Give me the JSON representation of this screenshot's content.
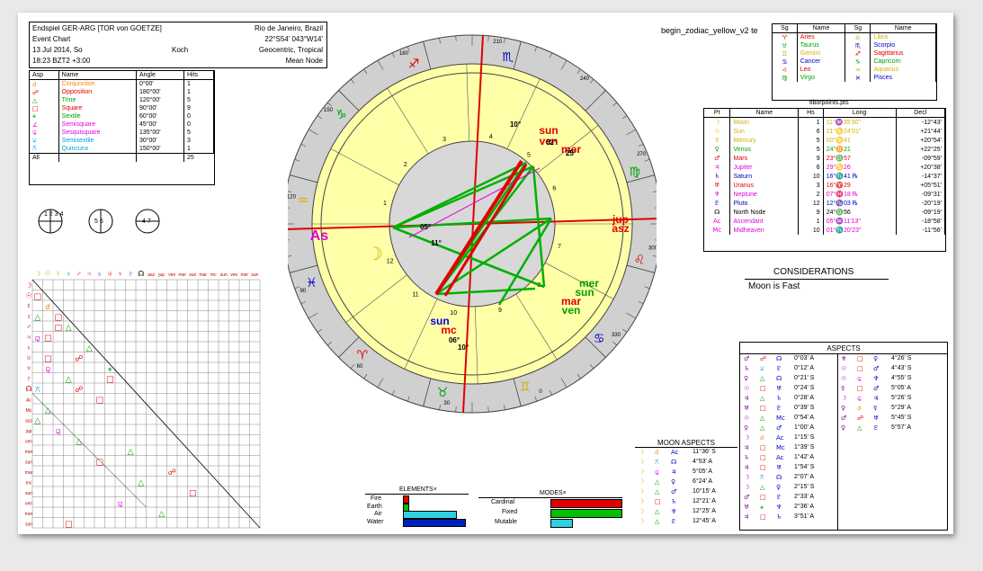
{
  "header": {
    "title": "Endspiel GER-ARG [TOR von GOETZE]",
    "type": "Event Chart",
    "date": "13 Jul 2014, So",
    "time": "18:23 BZT2 +3:00",
    "house_system": "Koch",
    "place": "Rio de Janeiro, Brazil",
    "coords": "22°S54' 043°W14'",
    "zodiac": "Geocentric, Tropical",
    "node": "Mean Node"
  },
  "file_label": "begin_zodiac_yellow_v2 te",
  "aspect_table": {
    "headers": [
      "Asp",
      "Name",
      "Angle",
      "Hits"
    ],
    "rows": [
      {
        "sym": "☌",
        "name": "Conjunction",
        "angle": "0°00'",
        "hits": "1",
        "color": "#ff8000"
      },
      {
        "sym": "☍",
        "name": "Opposition",
        "angle": "180°00'",
        "hits": "1",
        "color": "#e00000"
      },
      {
        "sym": "△",
        "name": "Trine",
        "angle": "120°00'",
        "hits": "5",
        "color": "#00a000"
      },
      {
        "sym": "□",
        "name": "Square",
        "angle": "90°00'",
        "hits": "9",
        "color": "#e00000"
      },
      {
        "sym": "⚹",
        "name": "Sextile",
        "angle": "60°00'",
        "hits": "0",
        "color": "#00a000"
      },
      {
        "sym": "∠",
        "name": "Semisquare",
        "angle": "45°00'",
        "hits": "0",
        "color": "#e000e0"
      },
      {
        "sym": "⚼",
        "name": "Sesquisquare",
        "angle": "135°00'",
        "hits": "5",
        "color": "#e000e0"
      },
      {
        "sym": "⚺",
        "name": "Semisextile",
        "angle": "30°00'",
        "hits": "3",
        "color": "#00a0e0"
      },
      {
        "sym": "⚻",
        "name": "Quincunx",
        "angle": "150°00'",
        "hits": "1",
        "color": "#00a0e0"
      }
    ],
    "all_label": "All",
    "all_hits": "25"
  },
  "circle_icons": [
    {
      "label": "1 2 3 4"
    },
    {
      "label": "5 6"
    },
    {
      "label": "4 7"
    }
  ],
  "wheel": {
    "degree_labels": [
      "210",
      "240",
      "270",
      "300",
      "330",
      "0",
      "30",
      "60",
      "90",
      "120",
      "150",
      "180"
    ],
    "house_numbers": [
      "1",
      "2",
      "3",
      "4",
      "5",
      "6",
      "7",
      "8",
      "9",
      "10",
      "11",
      "12"
    ],
    "planets": [
      {
        "name": "sun",
        "color": "#e00000"
      },
      {
        "name": "ven",
        "color": "#e00000"
      },
      {
        "name": "mer",
        "color": "#e00000"
      },
      {
        "name": "jup",
        "color": "#e00000"
      },
      {
        "name": "asz",
        "color": "#e00000"
      },
      {
        "name": "mer",
        "color": "#00a000"
      },
      {
        "name": "sun",
        "color": "#00a000"
      },
      {
        "name": "mar",
        "color": "#e00000"
      },
      {
        "name": "ven",
        "color": "#00a000"
      },
      {
        "name": "sun",
        "color": "#0000e0"
      },
      {
        "name": "mc",
        "color": "#e00000"
      },
      {
        "name": "As",
        "color": "#e000e0"
      }
    ],
    "degrees": [
      "10°",
      "02°",
      "25°",
      "08°",
      "04°",
      "16°",
      "13°",
      "12°",
      "10°",
      "06°",
      "10°",
      "05°",
      "11°"
    ]
  },
  "signs_table": {
    "headers": [
      "Sg",
      "Name",
      "Sg",
      "Name"
    ],
    "rows": [
      {
        "s1": "♈",
        "n1": "Aries",
        "c1": "#e00000",
        "s2": "♎",
        "n2": "Libra",
        "c2": "#d4b000"
      },
      {
        "s1": "♉",
        "n1": "Taurus",
        "c1": "#00a000",
        "s2": "♏",
        "n2": "Scorpio",
        "c2": "#0000c0"
      },
      {
        "s1": "♊",
        "n1": "Gemini",
        "c1": "#d4b000",
        "s2": "♐",
        "n2": "Sagittarius",
        "c2": "#e00000"
      },
      {
        "s1": "♋",
        "n1": "Cancer",
        "c1": "#0000c0",
        "s2": "♑",
        "n2": "Capricorn",
        "c2": "#00a000"
      },
      {
        "s1": "♌",
        "n1": "Leo",
        "c1": "#e00000",
        "s2": "♒",
        "n2": "Aquarius",
        "c2": "#d4b000"
      },
      {
        "s1": "♍",
        "n1": "Virgo",
        "c1": "#00a000",
        "s2": "♓",
        "n2": "Pisces",
        "c2": "#0000c0"
      }
    ]
  },
  "points_table": {
    "title": "tiborpoints.pts",
    "headers": [
      "Pt",
      "Name",
      "Hs",
      "Long",
      "Decl"
    ],
    "rows": [
      {
        "pt": "☽",
        "name": "Moon",
        "hs": "1",
        "long": "11°♒35'30\"",
        "decl": "-12°43'",
        "color": "#d4b000"
      },
      {
        "pt": "☉",
        "name": "Sun",
        "hs": "6",
        "long": "21°♋24'01\"",
        "decl": "+21°44'",
        "color": "#d4b000"
      },
      {
        "pt": "☿",
        "name": "Mercury",
        "hs": "5",
        "long": "00°♋41",
        "decl": "+20°54'",
        "color": "#d4b000"
      },
      {
        "pt": "♀",
        "name": "Venus",
        "hs": "5",
        "long": "24°♊21",
        "decl": "+22°25'",
        "color": "#00a000"
      },
      {
        "pt": "♂",
        "name": "Mars",
        "hs": "9",
        "long": "23°♎57",
        "decl": "-09°59'",
        "color": "#e00000"
      },
      {
        "pt": "♃",
        "name": "Jupiter",
        "hs": "6",
        "long": "29°♋26",
        "decl": "+20°38'",
        "color": "#e000e0"
      },
      {
        "pt": "♄",
        "name": "Saturn",
        "hs": "10",
        "long": "16°♏41 ℞",
        "decl": "-14°37'",
        "color": "#0000c0"
      },
      {
        "pt": "♅",
        "name": "Uranus",
        "hs": "3",
        "long": "16°♈29",
        "decl": "+05°51'",
        "color": "#e00000"
      },
      {
        "pt": "♆",
        "name": "Neptune",
        "hs": "2",
        "long": "07°♓18 ℞",
        "decl": "-09°31'",
        "color": "#e000e0"
      },
      {
        "pt": "♇",
        "name": "Pluto",
        "hs": "12",
        "long": "12°♑03 ℞",
        "decl": "-20°19'",
        "color": "#0000c0"
      },
      {
        "pt": "☊",
        "name": "North Node",
        "hs": "9",
        "long": "24°♎56",
        "decl": "-09°19'",
        "color": "#000000"
      },
      {
        "pt": "Ac",
        "name": "Ascendant",
        "hs": "1",
        "long": "05°♒11'13\"",
        "decl": "-18°58'",
        "color": "#e000e0"
      },
      {
        "pt": "Mc",
        "name": "Midheaven",
        "hs": "10",
        "long": "01°♏20'23\"",
        "decl": "-11°56'",
        "color": "#e000e0"
      }
    ]
  },
  "considerations": {
    "title": "CONSIDERATIONS",
    "text": "Moon is Fast"
  },
  "aspects_list": {
    "title": "ASPECTS",
    "left": [
      {
        "a": "♂",
        "asp": "☍",
        "b": "☊",
        "val": "0°03' A"
      },
      {
        "a": "♄",
        "asp": "⚺",
        "b": "♇",
        "val": "0°12' A"
      },
      {
        "a": "♀",
        "asp": "△",
        "b": "☊",
        "val": "0°21' S"
      },
      {
        "a": "☉",
        "asp": "□",
        "b": "♅",
        "val": "0°24' S"
      },
      {
        "a": "♃",
        "asp": "△",
        "b": "♄",
        "val": "0°28' A"
      },
      {
        "a": "♅",
        "asp": "□",
        "b": "♇",
        "val": "0°39' S"
      },
      {
        "a": "☉",
        "asp": "△",
        "b": "Mc",
        "val": "0°54' A"
      },
      {
        "a": "♀",
        "asp": "△",
        "b": "♂",
        "val": "1°00' A"
      },
      {
        "a": "☽",
        "asp": "☌",
        "b": "Ac",
        "val": "1°15' S"
      },
      {
        "a": "♃",
        "asp": "□",
        "b": "Mc",
        "val": "1°39' S"
      },
      {
        "a": "♄",
        "asp": "□",
        "b": "Ac",
        "val": "1°42' A"
      },
      {
        "a": "♃",
        "asp": "□",
        "b": "♅",
        "val": "1°54' S"
      },
      {
        "a": "☽",
        "asp": "⚻",
        "b": "☊",
        "val": "2°07' A"
      },
      {
        "a": "☽",
        "asp": "△",
        "b": "♀",
        "val": "2°15' S"
      },
      {
        "a": "♂",
        "asp": "□",
        "b": "♇",
        "val": "2°33' A"
      },
      {
        "a": "♅",
        "asp": "⚹",
        "b": "♆",
        "val": "2°36' A"
      },
      {
        "a": "♃",
        "asp": "□",
        "b": "♄",
        "val": "3°51' A"
      }
    ],
    "right": [
      {
        "a": "♆",
        "asp": "□",
        "b": "♀",
        "val": "4°26' S"
      },
      {
        "a": "☉",
        "asp": "□",
        "b": "♂",
        "val": "4°43' S"
      },
      {
        "a": "☉",
        "asp": "⚼",
        "b": "♆",
        "val": "4°55' S"
      },
      {
        "a": "☿",
        "asp": "□",
        "b": "♂",
        "val": "5°05' A"
      },
      {
        "a": "☽",
        "asp": "⚼",
        "b": "♃",
        "val": "5°26' S"
      },
      {
        "a": "♀",
        "asp": "☌",
        "b": "☿",
        "val": "5°29' A"
      },
      {
        "a": "♂",
        "asp": "☍",
        "b": "♅",
        "val": "5°45' S"
      },
      {
        "a": "♀",
        "asp": "△",
        "b": "♇",
        "val": "5°57' A"
      }
    ]
  },
  "moon_aspects": {
    "title": "MOON ASPECTS",
    "rows": [
      {
        "asp": "☌",
        "b": "Ac",
        "val": "11°36' S"
      },
      {
        "asp": "⚻",
        "b": "☊",
        "val": "4°53' A"
      },
      {
        "asp": "⚼",
        "b": "♃",
        "val": "5°05' A"
      },
      {
        "asp": "△",
        "b": "♀",
        "val": "6°24' A"
      },
      {
        "asp": "△",
        "b": "♂",
        "val": "10°15' A"
      },
      {
        "asp": "□",
        "b": "♄",
        "val": "12°21' A"
      },
      {
        "asp": "△",
        "b": "♆",
        "val": "12°25' A"
      },
      {
        "asp": "△",
        "b": "♇",
        "val": "12°45' A"
      }
    ]
  },
  "elements": {
    "title": "ELEMENTS×",
    "items": [
      {
        "label": "Fire",
        "value": 0.08,
        "color": "#e00000"
      },
      {
        "label": "Earth",
        "value": 0.08,
        "color": "#00c000"
      },
      {
        "label": "Air",
        "value": 0.85,
        "color": "#30d0e0"
      },
      {
        "label": "Water",
        "value": 1.0,
        "color": "#0020c0"
      }
    ]
  },
  "modes": {
    "title": "MODES×",
    "items": [
      {
        "label": "Cardinal",
        "value": 1.0,
        "color": "#e00000"
      },
      {
        "label": "Fixed",
        "value": 1.0,
        "color": "#00c000"
      },
      {
        "label": "Mutable",
        "value": 0.3,
        "color": "#30d0e0"
      }
    ]
  },
  "grid_labels": {
    "top": [
      "☽",
      "☉",
      "☿",
      "♀",
      "♂",
      "♃",
      "♄",
      "♅",
      "♆",
      "♇",
      "☊",
      "asz",
      "jup",
      "ven",
      "mer",
      "sun",
      "mar",
      "mc",
      "sun",
      "ven",
      "mer",
      "sun"
    ],
    "side": [
      "☽",
      "☉",
      "☿",
      "♀",
      "♂",
      "♃",
      "♄",
      "♅",
      "♆",
      "♇",
      "☊",
      "Ac",
      "Mc",
      "asz",
      "jup",
      "ven",
      "mer",
      "sun",
      "mar",
      "mc",
      "sun",
      "ven",
      "mer",
      "sun"
    ]
  }
}
